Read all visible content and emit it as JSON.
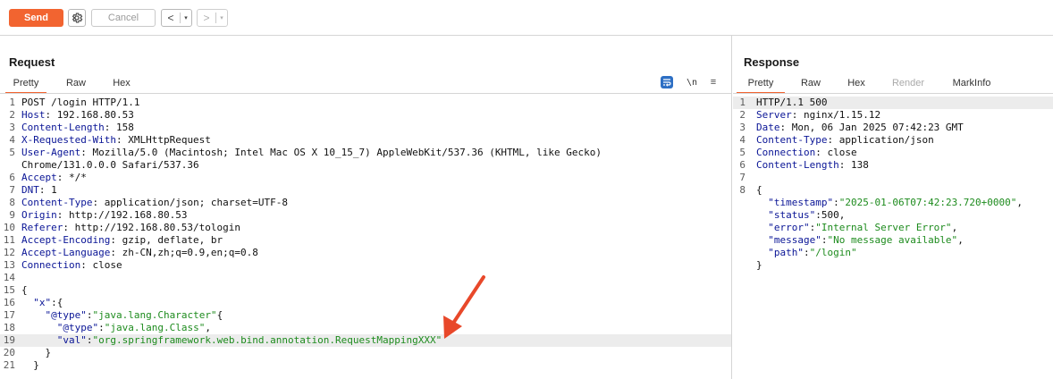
{
  "toolbar": {
    "send_label": "Send",
    "cancel_label": "Cancel",
    "back_glyph": "<",
    "forward_glyph": ">",
    "dropdown_glyph": "▾",
    "gear_icon": "gear-icon"
  },
  "request": {
    "title": "Request",
    "tabs": [
      "Pretty",
      "Raw",
      "Hex"
    ],
    "newline_label": "\\n",
    "menu_glyph": "≡",
    "lines": [
      {
        "n": "1",
        "parts": [
          {
            "c": "plain",
            "t": "POST /login HTTP/1.1"
          }
        ]
      },
      {
        "n": "2",
        "parts": [
          {
            "c": "hdr",
            "t": "Host"
          },
          {
            "c": "plain",
            "t": ": 192.168.80.53"
          }
        ]
      },
      {
        "n": "3",
        "parts": [
          {
            "c": "hdr",
            "t": "Content-Length"
          },
          {
            "c": "plain",
            "t": ": 158"
          }
        ]
      },
      {
        "n": "4",
        "parts": [
          {
            "c": "hdr",
            "t": "X-Requested-With"
          },
          {
            "c": "plain",
            "t": ": XMLHttpRequest"
          }
        ]
      },
      {
        "n": "5",
        "parts": [
          {
            "c": "hdr",
            "t": "User-Agent"
          },
          {
            "c": "plain",
            "t": ": Mozilla/5.0 (Macintosh; Intel Mac OS X 10_15_7) AppleWebKit/537.36 (KHTML, like Gecko)"
          }
        ]
      },
      {
        "n": "",
        "parts": [
          {
            "c": "plain",
            "t": "Chrome/131.0.0.0 Safari/537.36"
          }
        ]
      },
      {
        "n": "6",
        "parts": [
          {
            "c": "hdr",
            "t": "Accept"
          },
          {
            "c": "plain",
            "t": ": */*"
          }
        ]
      },
      {
        "n": "7",
        "parts": [
          {
            "c": "hdr",
            "t": "DNT"
          },
          {
            "c": "plain",
            "t": ": 1"
          }
        ]
      },
      {
        "n": "8",
        "parts": [
          {
            "c": "hdr",
            "t": "Content-Type"
          },
          {
            "c": "plain",
            "t": ": application/json; charset=UTF-8"
          }
        ]
      },
      {
        "n": "9",
        "parts": [
          {
            "c": "hdr",
            "t": "Origin"
          },
          {
            "c": "plain",
            "t": ": http://192.168.80.53"
          }
        ]
      },
      {
        "n": "10",
        "parts": [
          {
            "c": "hdr",
            "t": "Referer"
          },
          {
            "c": "plain",
            "t": ": http://192.168.80.53/tologin"
          }
        ]
      },
      {
        "n": "11",
        "parts": [
          {
            "c": "hdr",
            "t": "Accept-Encoding"
          },
          {
            "c": "plain",
            "t": ": gzip, deflate, br"
          }
        ]
      },
      {
        "n": "12",
        "parts": [
          {
            "c": "hdr",
            "t": "Accept-Language"
          },
          {
            "c": "plain",
            "t": ": zh-CN,zh;q=0.9,en;q=0.8"
          }
        ]
      },
      {
        "n": "13",
        "parts": [
          {
            "c": "hdr",
            "t": "Connection"
          },
          {
            "c": "plain",
            "t": ": close"
          }
        ]
      },
      {
        "n": "14",
        "parts": []
      },
      {
        "n": "15",
        "parts": [
          {
            "c": "plain",
            "t": "{"
          }
        ]
      },
      {
        "n": "16",
        "parts": [
          {
            "c": "plain",
            "t": "  "
          },
          {
            "c": "key",
            "t": "\"x\""
          },
          {
            "c": "plain",
            "t": ":{"
          }
        ]
      },
      {
        "n": "17",
        "parts": [
          {
            "c": "plain",
            "t": "    "
          },
          {
            "c": "key",
            "t": "\"@type\""
          },
          {
            "c": "plain",
            "t": ":"
          },
          {
            "c": "str",
            "t": "\"java.lang.Character\""
          },
          {
            "c": "plain",
            "t": "{"
          }
        ]
      },
      {
        "n": "18",
        "parts": [
          {
            "c": "plain",
            "t": "      "
          },
          {
            "c": "key",
            "t": "\"@type\""
          },
          {
            "c": "plain",
            "t": ":"
          },
          {
            "c": "str",
            "t": "\"java.lang.Class\""
          },
          {
            "c": "plain",
            "t": ","
          }
        ]
      },
      {
        "n": "19",
        "hl": true,
        "parts": [
          {
            "c": "plain",
            "t": "      "
          },
          {
            "c": "key",
            "t": "\"val\""
          },
          {
            "c": "plain",
            "t": ":"
          },
          {
            "c": "str",
            "t": "\"org.springframework.web.bind.annotation.RequestMappingXXX\""
          }
        ]
      },
      {
        "n": "20",
        "parts": [
          {
            "c": "plain",
            "t": "    }"
          }
        ]
      },
      {
        "n": "21",
        "parts": [
          {
            "c": "plain",
            "t": "  }"
          }
        ]
      }
    ]
  },
  "response": {
    "title": "Response",
    "tabs": [
      "Pretty",
      "Raw",
      "Hex",
      "Render",
      "MarkInfo"
    ],
    "lines": [
      {
        "n": "1",
        "hl": true,
        "parts": [
          {
            "c": "plain",
            "t": "HTTP/1.1 500"
          }
        ]
      },
      {
        "n": "2",
        "parts": [
          {
            "c": "hdr",
            "t": "Server"
          },
          {
            "c": "plain",
            "t": ": nginx/1.15.12"
          }
        ]
      },
      {
        "n": "3",
        "parts": [
          {
            "c": "hdr",
            "t": "Date"
          },
          {
            "c": "plain",
            "t": ": Mon, 06 Jan 2025 07:42:23 GMT"
          }
        ]
      },
      {
        "n": "4",
        "parts": [
          {
            "c": "hdr",
            "t": "Content-Type"
          },
          {
            "c": "plain",
            "t": ": application/json"
          }
        ]
      },
      {
        "n": "5",
        "parts": [
          {
            "c": "hdr",
            "t": "Connection"
          },
          {
            "c": "plain",
            "t": ": close"
          }
        ]
      },
      {
        "n": "6",
        "parts": [
          {
            "c": "hdr",
            "t": "Content-Length"
          },
          {
            "c": "plain",
            "t": ": 138"
          }
        ]
      },
      {
        "n": "7",
        "parts": []
      },
      {
        "n": "8",
        "parts": [
          {
            "c": "plain",
            "t": "{"
          }
        ]
      },
      {
        "n": "",
        "parts": [
          {
            "c": "plain",
            "t": "  "
          },
          {
            "c": "key",
            "t": "\"timestamp\""
          },
          {
            "c": "plain",
            "t": ":"
          },
          {
            "c": "str",
            "t": "\"2025-01-06T07:42:23.720+0000\""
          },
          {
            "c": "plain",
            "t": ","
          }
        ]
      },
      {
        "n": "",
        "parts": [
          {
            "c": "plain",
            "t": "  "
          },
          {
            "c": "key",
            "t": "\"status\""
          },
          {
            "c": "plain",
            "t": ":500,"
          }
        ]
      },
      {
        "n": "",
        "parts": [
          {
            "c": "plain",
            "t": "  "
          },
          {
            "c": "key",
            "t": "\"error\""
          },
          {
            "c": "plain",
            "t": ":"
          },
          {
            "c": "str",
            "t": "\"Internal Server Error\""
          },
          {
            "c": "plain",
            "t": ","
          }
        ]
      },
      {
        "n": "",
        "parts": [
          {
            "c": "plain",
            "t": "  "
          },
          {
            "c": "key",
            "t": "\"message\""
          },
          {
            "c": "plain",
            "t": ":"
          },
          {
            "c": "str",
            "t": "\"No message available\""
          },
          {
            "c": "plain",
            "t": ","
          }
        ]
      },
      {
        "n": "",
        "parts": [
          {
            "c": "plain",
            "t": "  "
          },
          {
            "c": "key",
            "t": "\"path\""
          },
          {
            "c": "plain",
            "t": ":"
          },
          {
            "c": "str",
            "t": "\"/login\""
          }
        ]
      },
      {
        "n": "",
        "parts": [
          {
            "c": "plain",
            "t": "}"
          }
        ]
      }
    ]
  },
  "colors": {
    "accent": "#f26430",
    "header_name": "#0a1596",
    "string_value": "#1d8b1d",
    "annotation_arrow": "#e8482a"
  }
}
